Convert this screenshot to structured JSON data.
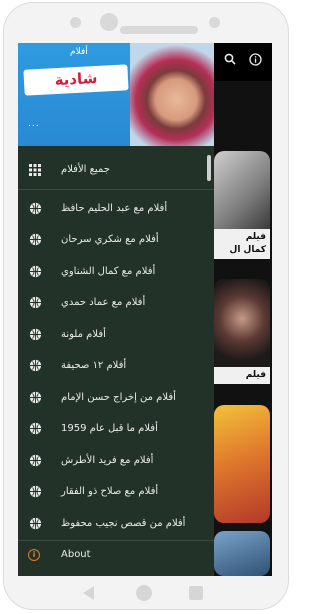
{
  "header": {
    "logo_small": "أفلام",
    "logo_main": "شادية",
    "dots": "..."
  },
  "appbar": {
    "search_icon": "search-icon",
    "info_icon": "info-icon"
  },
  "menu": {
    "items": [
      {
        "label": "جميع الأفلام",
        "icon": "grid-icon"
      },
      {
        "label": "أفلام مع عبد الحليم حافظ",
        "icon": "globe-icon"
      },
      {
        "label": "أفلام مع شكري سرحان",
        "icon": "globe-icon"
      },
      {
        "label": "أفلام مع كمال الشناوي",
        "icon": "globe-icon"
      },
      {
        "label": "أفلام مع عماد حمدي",
        "icon": "globe-icon"
      },
      {
        "label": "أفلام ملونة",
        "icon": "globe-icon"
      },
      {
        "label": "أفلام ١٢ صحيفة",
        "icon": "globe-icon"
      },
      {
        "label": "أفلام من إخراج حسن الإمام",
        "icon": "globe-icon"
      },
      {
        "label": "أفلام ما قبل عام 1959",
        "icon": "globe-icon"
      },
      {
        "label": "أفلام مع فريد الأطرش",
        "icon": "globe-icon"
      },
      {
        "label": "أفلام مع صلاح ذو الفقار",
        "icon": "globe-icon"
      },
      {
        "label": "أفلام من قصص نجيب محفوظ",
        "icon": "globe-icon"
      }
    ],
    "about_label": "About",
    "about_icon": "info-circle-icon"
  },
  "cards": [
    {
      "caption_1": "فيلم",
      "caption_2": "كمال ال"
    },
    {
      "caption_1": "فيلم",
      "caption_2": ""
    }
  ],
  "colors": {
    "drawer_bg": "#233228",
    "header_bg": "#2a89d4",
    "logo_text": "#d81b3c",
    "about_icon": "#e07b28"
  }
}
